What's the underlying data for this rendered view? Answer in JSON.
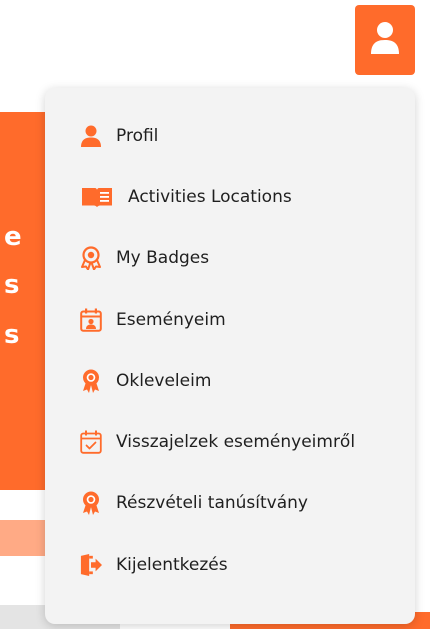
{
  "accent_color": "#ff6b2b",
  "background": {
    "banner_letters": [
      "e",
      "s",
      "s"
    ]
  },
  "header": {
    "user_button_icon": "user-icon"
  },
  "menu": {
    "items": [
      {
        "label": "Profil",
        "icon": "user-icon"
      },
      {
        "label": "Activities Locations",
        "icon": "book-icon"
      },
      {
        "label": "My Badges",
        "icon": "badge-icon"
      },
      {
        "label": "Eseményeim",
        "icon": "calendar-user-icon"
      },
      {
        "label": "Okleveleim",
        "icon": "award-icon"
      },
      {
        "label": "Visszajelzek eseményeimről",
        "icon": "calendar-check-icon"
      },
      {
        "label": "Részvételi tanúsítvány",
        "icon": "award-icon"
      },
      {
        "label": "Kijelentkezés",
        "icon": "logout-icon"
      }
    ]
  }
}
